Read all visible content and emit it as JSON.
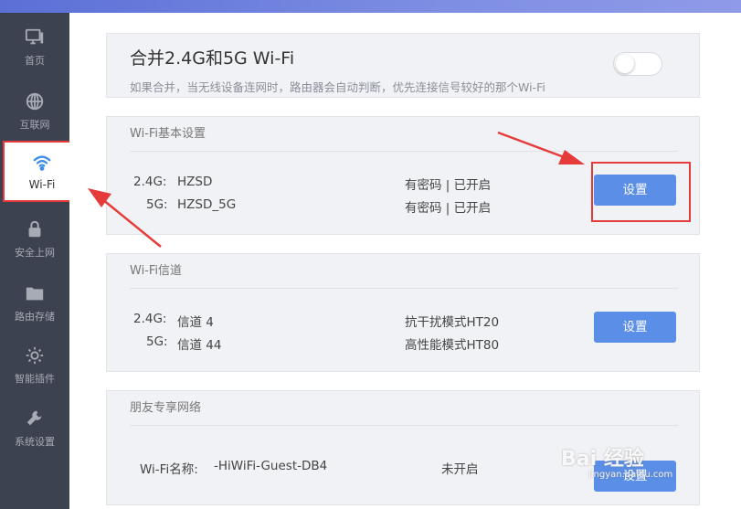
{
  "sidebar": {
    "items": [
      {
        "label": "首页",
        "icon": "monitor-icon"
      },
      {
        "label": "互联网",
        "icon": "globe-icon"
      },
      {
        "label": "Wi-Fi",
        "icon": "wifi-icon",
        "active": true
      },
      {
        "label": "安全上网",
        "icon": "lock-icon"
      },
      {
        "label": "路由存储",
        "icon": "folder-icon"
      },
      {
        "label": "智能插件",
        "icon": "sun-icon"
      },
      {
        "label": "系统设置",
        "icon": "wrench-icon"
      }
    ]
  },
  "merge": {
    "title": "合并2.4G和5G Wi-Fi",
    "description": "如果合并，当无线设备连网时，路由器会自动判断，优先连接信号较好的那个Wi-Fi",
    "enabled": false
  },
  "basic": {
    "heading": "Wi-Fi基本设置",
    "row1_band": "2.4G:",
    "row1_name": "HZSD",
    "row1_status": "有密码 | 已开启",
    "row2_band": "5G:",
    "row2_name": "HZSD_5G",
    "row2_status": "有密码 | 已开启",
    "button": "设置"
  },
  "channel": {
    "heading": "Wi-Fi信道",
    "row1_band": "2.4G:",
    "row1_value": "信道 4",
    "row1_mode": "抗干扰模式HT20",
    "row2_band": "5G:",
    "row2_value": "信道 44",
    "row2_mode": "高性能模式HT80",
    "button": "设置"
  },
  "guest": {
    "heading": "朋友专享网络",
    "name_label": "Wi-Fi名称:",
    "name_value": "-HiWiFi-Guest-DB4",
    "status": "未开启",
    "button": "设置"
  },
  "watermark": {
    "text": "Bai 经验",
    "sub": "jingyan.baidu.com"
  },
  "colors": {
    "sidebar_bg": "#3c4250",
    "accent_button": "#5b8ee6",
    "annotation_red": "#e63b3b",
    "card_bg": "#f1f2f5"
  }
}
